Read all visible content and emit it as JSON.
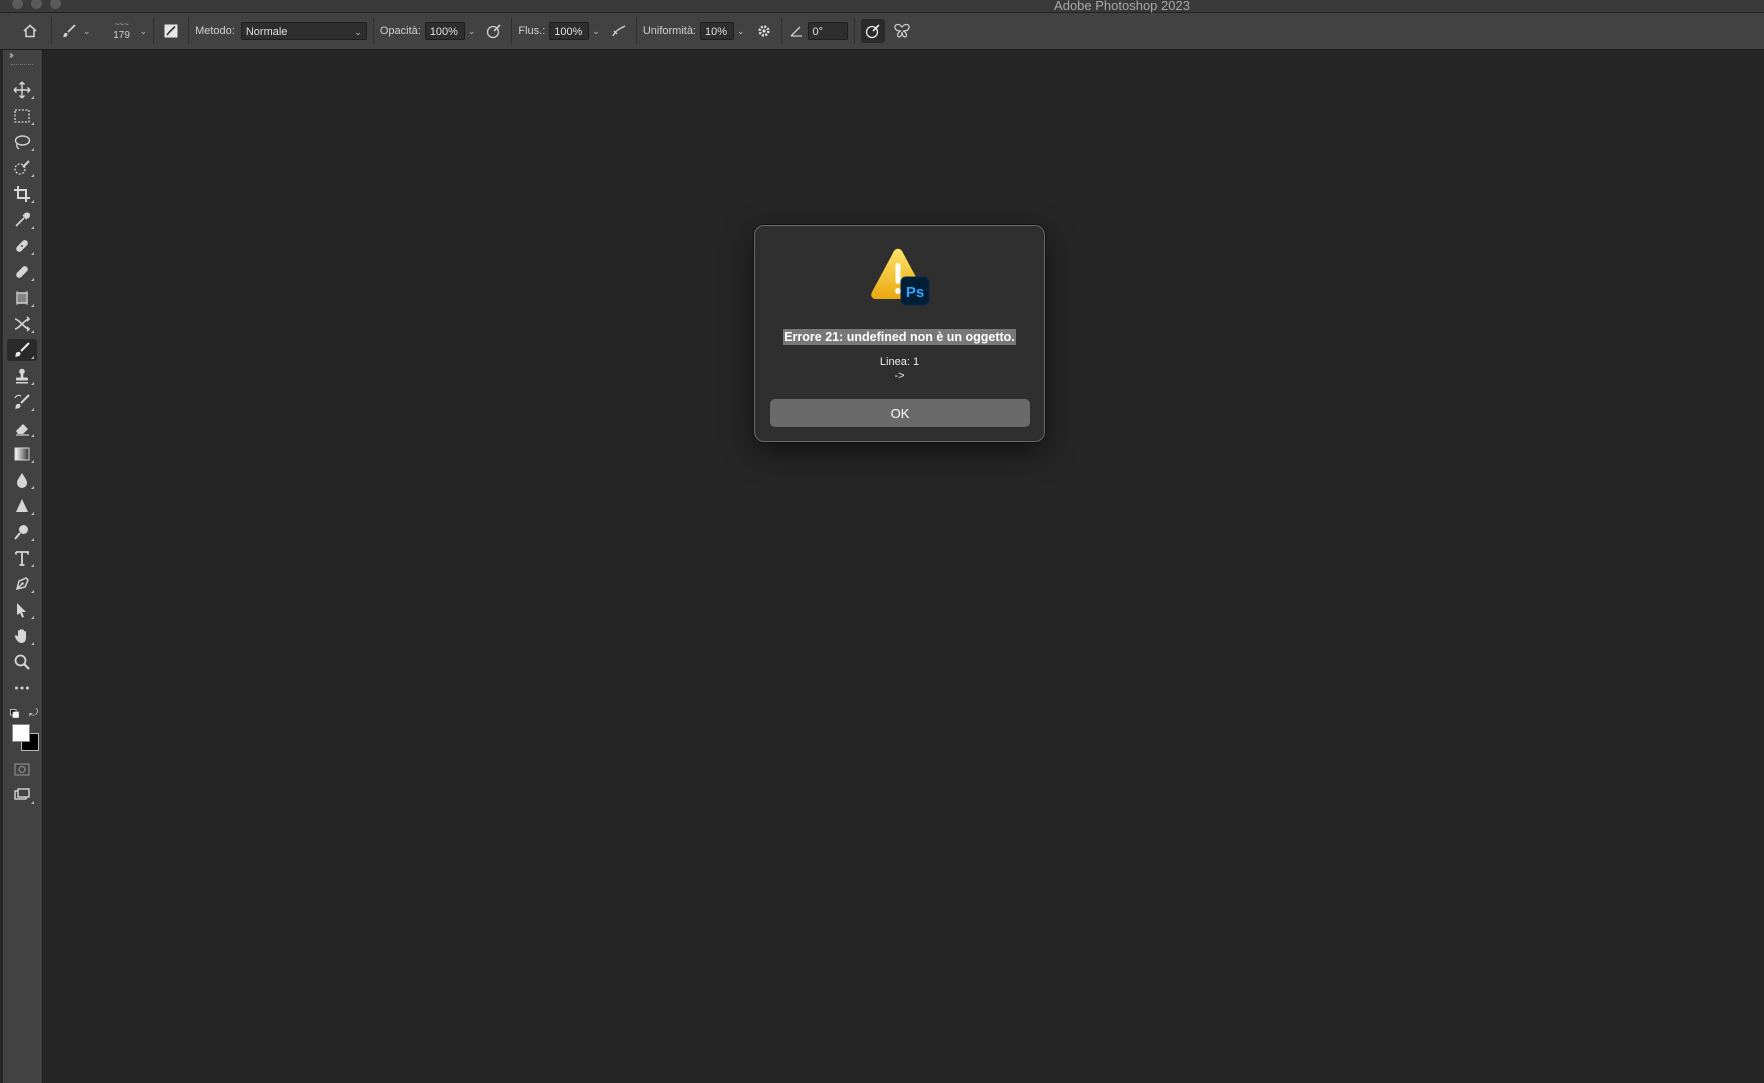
{
  "window": {
    "title": "Adobe Photoshop 2023"
  },
  "options_bar": {
    "brush_size": "179",
    "method_label": "Metodo:",
    "method_value": "Normale",
    "opacity_label": "Opacità:",
    "opacity_value": "100%",
    "flow_label": "Flus.:",
    "flow_value": "100%",
    "smoothing_label": "Uniformità:",
    "smoothing_value": "10%",
    "angle_value": "0°"
  },
  "toolbar": {
    "tools": [
      "move-tool",
      "rectangular-marquee-tool",
      "lasso-tool",
      "quick-selection-tool",
      "crop-tool",
      "eyedropper-tool",
      "spot-healing-tool",
      "healing-brush-tool",
      "frame-tool",
      "content-aware-move-tool",
      "brush-tool",
      "clone-stamp-tool",
      "history-brush-tool",
      "eraser-tool",
      "gradient-tool",
      "blur-tool",
      "sharpen-tool",
      "dodge-tool",
      "type-tool",
      "pen-tool",
      "path-selection-tool",
      "hand-tool",
      "zoom-tool",
      "more-tools"
    ],
    "active_tool": "brush-tool",
    "foreground_color": "#ffffff",
    "background_color": "#000000"
  },
  "dialog": {
    "title": "Errore 21: undefined non è un oggetto.",
    "line": "Linea: 1",
    "arrow": "->",
    "ok_label": "OK",
    "icon": "warning-triangle-photoshop-icon"
  },
  "colors": {
    "canvas": "#262626",
    "panel": "#424242",
    "dialog_bg": "#2f2f2f",
    "warning_yellow": "#f4c01e",
    "ps_blue": "#31a8ff"
  }
}
